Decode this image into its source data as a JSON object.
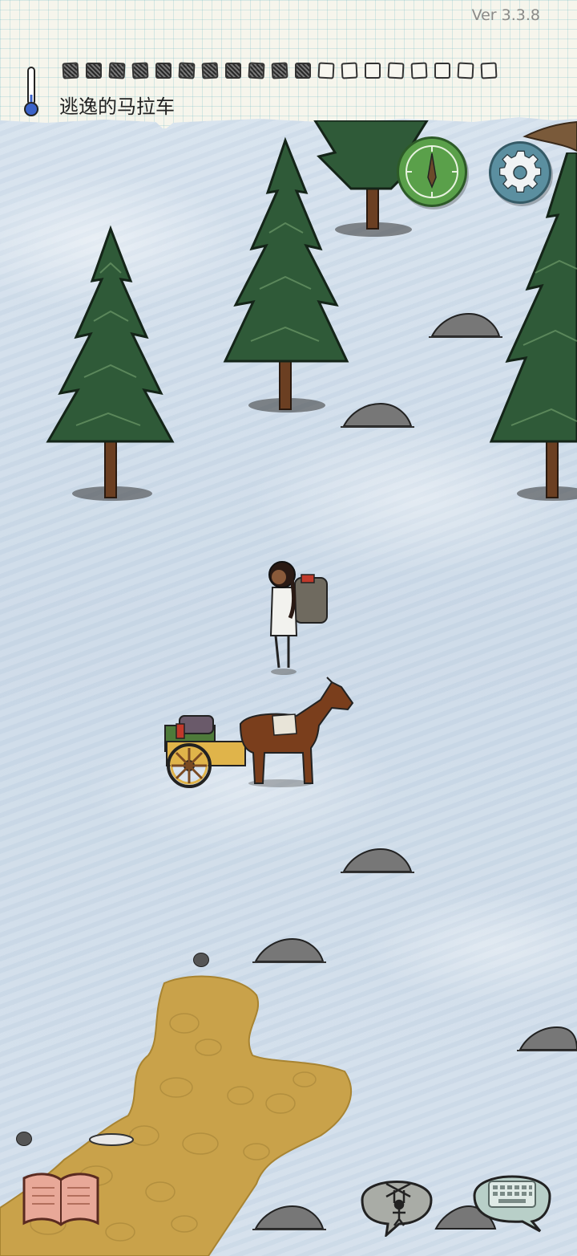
{
  "header": {
    "version": "Ver 3.3.8",
    "title": "逃逸的马拉车",
    "days_total": 19,
    "days_filled": 11
  },
  "buttons": {
    "compass": "compass-icon",
    "settings": "gear-icon",
    "journal": "book-icon",
    "puppet": "puppet-icon",
    "keyboard": "keyboard-icon"
  },
  "colors": {
    "snow": "#cfdbe8",
    "paper": "#f6f5ec",
    "compass_green": "#5aa04a",
    "gear_blue": "#5b8fa0",
    "dirt": "#c9a24a",
    "tree_green": "#2f5a38"
  }
}
